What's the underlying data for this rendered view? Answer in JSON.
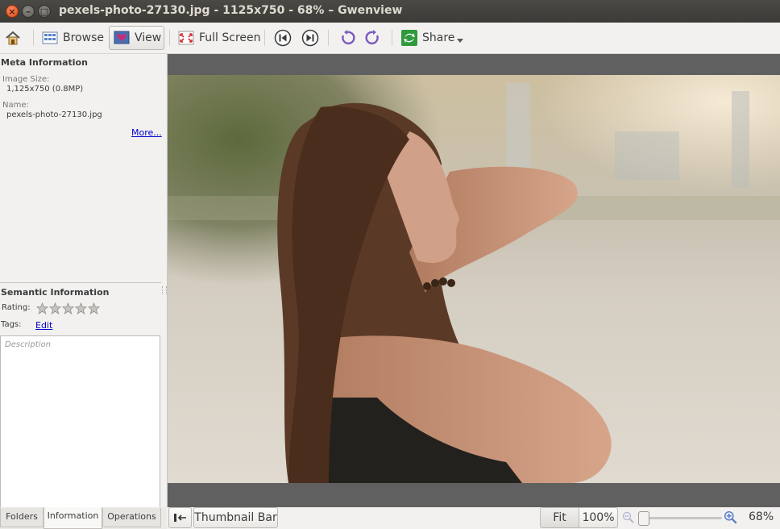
{
  "window": {
    "title": "pexels-photo-27130.jpg - 1125x750 - 68% – Gwenview",
    "close_glyph": "×",
    "minimize_glyph": "–",
    "maximize_glyph": "□"
  },
  "toolbar": {
    "browse_label": "Browse",
    "view_label": "View",
    "fullscreen_label": "Full Screen",
    "share_label": "Share"
  },
  "sidebar": {
    "meta_title": "Meta Information",
    "image_size_label": "Image Size:",
    "image_size_value": "1,125x750 (0.8MP)",
    "name_label": "Name:",
    "name_value": "pexels-photo-27130.jpg",
    "more_link": "More...",
    "semantic_title": "Semantic Information",
    "rating_label": "Rating:",
    "rating_value": 0,
    "rating_max": 5,
    "tags_label": "Tags:",
    "edit_link": "Edit",
    "description_placeholder": "Description"
  },
  "tabs": {
    "folders": "Folders",
    "information": "Information",
    "operations": "Operations"
  },
  "statusbar": {
    "thumbnail_bar_label": "Thumbnail Bar",
    "fit_label": "Fit",
    "hundred_label": "100%",
    "zoom_value": "68%"
  },
  "colors": {
    "titlebar": "#3c3b37",
    "close_button": "#df4b16",
    "link": "#0000cc",
    "viewer_background": "#606060"
  }
}
